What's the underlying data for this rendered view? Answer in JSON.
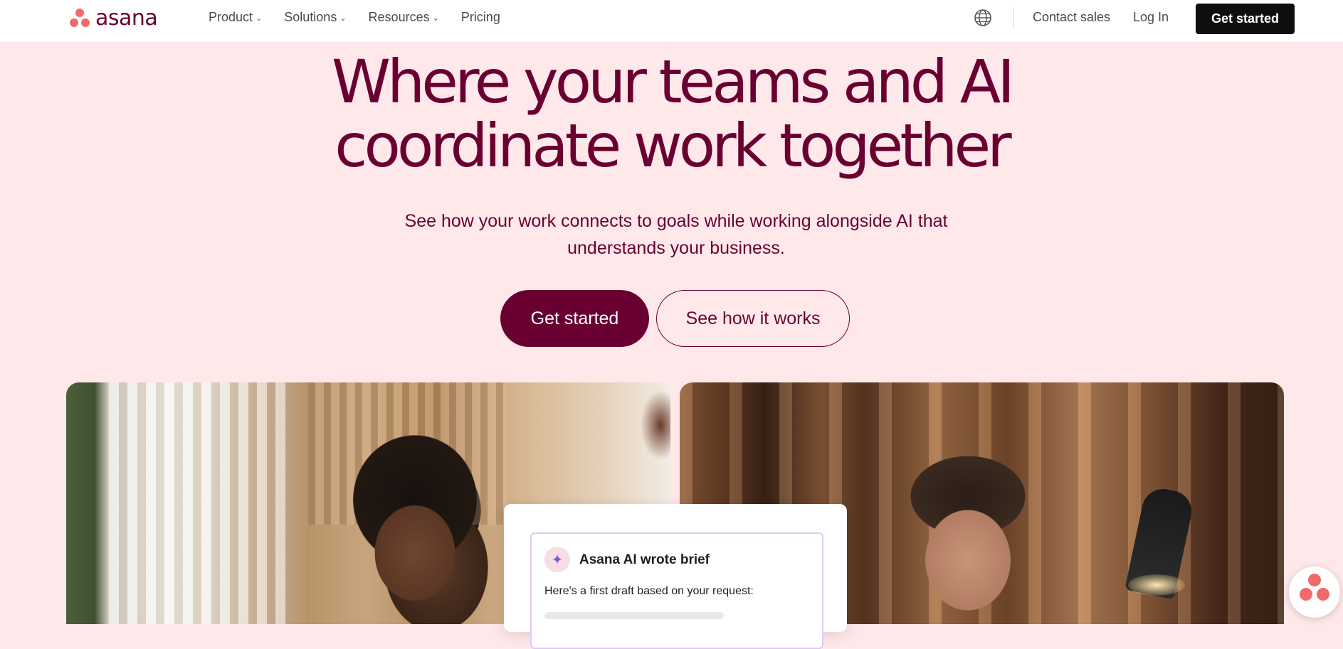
{
  "brand": {
    "name": "asana",
    "accent": "#690031",
    "logo_color": "#f06a6a"
  },
  "nav": {
    "items": [
      {
        "label": "Product",
        "has_dropdown": true
      },
      {
        "label": "Solutions",
        "has_dropdown": true
      },
      {
        "label": "Resources",
        "has_dropdown": true
      },
      {
        "label": "Pricing",
        "has_dropdown": false
      }
    ],
    "globe_icon": "globe-icon",
    "contact_sales": "Contact sales",
    "log_in": "Log In",
    "get_started": "Get started"
  },
  "hero": {
    "title_line1": "Where your teams and AI",
    "title_line2": "coordinate work together",
    "subtitle_line1": "See how your work connects to goals while working alongside AI that",
    "subtitle_line2": "understands your business.",
    "primary_cta": "Get started",
    "secondary_cta": "See how it works",
    "background": "#ffe8ea"
  },
  "ai_card": {
    "title": "Asana AI wrote brief",
    "text": "Here's a first draft based on your request:",
    "icon": "sparkle-icon"
  },
  "chat": {
    "icon": "asana-chat-icon"
  }
}
